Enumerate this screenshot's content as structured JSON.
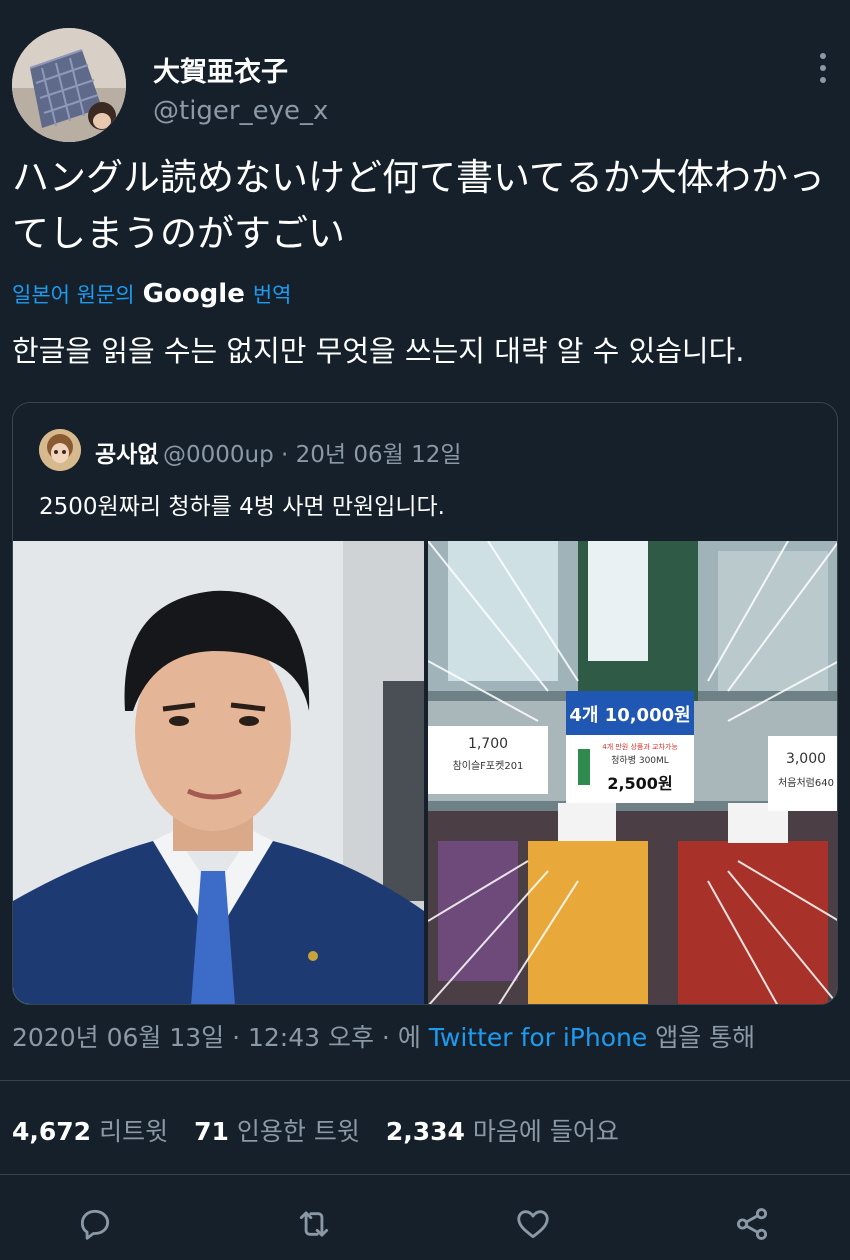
{
  "author": {
    "name": "大賀亜衣子",
    "handle": "@tiger_eye_x"
  },
  "tweet": {
    "text": "ハングル読めないけど何て書いてるか大体わかってしまうのがすごい",
    "translate_prefix": "일본어 원문의",
    "translate_google": "Google",
    "translate_suffix": "번역",
    "translated_text": "한글을 읽을 수는 없지만 무엇을 쓰는지 대략 알 수 있습니다."
  },
  "quoted": {
    "name": "공사없",
    "meta": "@0000up · 20년 06월 12일",
    "text": "2500원짜리 청하를 4병 사면 만원입니다.",
    "shelf_labels": {
      "price_left": "1,700",
      "product_left": "참이슬F포켓201",
      "promo": "4개 10,000원",
      "promo_small": "4개 만원 상품과 교차가능",
      "product_center": "청하병 300ML",
      "price_center": "2,500원",
      "price_right": "3,000",
      "product_right": "처음처럼640"
    }
  },
  "timestamp": {
    "date": "2020년 06월 13일 · 12:43 오후 · 에",
    "client": "Twitter for iPhone",
    "suffix": "앱을 통해"
  },
  "stats": {
    "retweets": "4,672",
    "retweets_label": "리트윗",
    "quotes": "71",
    "quotes_label": "인용한 트윗",
    "likes": "2,334",
    "likes_label": "마음에 들어요"
  },
  "icons": [
    "reply-icon",
    "retweet-icon",
    "like-icon",
    "share-icon",
    "more-icon"
  ],
  "colors": {
    "background": "#15202b",
    "accent": "#1d9bf0",
    "secondary_text": "#8b98a5",
    "border": "#38444d"
  }
}
